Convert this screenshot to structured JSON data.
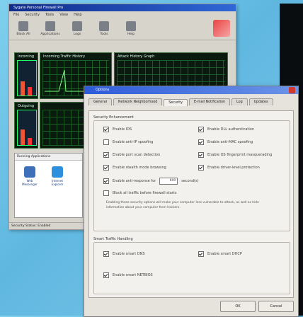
{
  "main": {
    "title": "Sygate Personal Firewall Pro",
    "menu": [
      "File",
      "Security",
      "Tools",
      "View",
      "Help"
    ],
    "toolbar": [
      {
        "label": "Block All",
        "icon": "stop-icon"
      },
      {
        "label": "Applications",
        "icon": "apps-icon"
      },
      {
        "label": "Logs",
        "icon": "logs-icon"
      },
      {
        "label": "Tools",
        "icon": "tools-icon"
      },
      {
        "label": "Help",
        "icon": "help-icon"
      }
    ],
    "panels": {
      "incoming": "Incoming",
      "traffic_history": "Incoming Traffic History",
      "attack_history": "Attack History Graph",
      "outgoing": "Outgoing"
    },
    "running_apps": {
      "header": "Running Applications",
      "apps": [
        "Web Messenger",
        "Internet Explorer"
      ]
    },
    "status": "Security Status: Enabled"
  },
  "dialog": {
    "title": "Options",
    "tabs": [
      "General",
      "Network Neighborhood",
      "Security",
      "E-mail Notification",
      "Log",
      "Updates"
    ],
    "active_tab": "Security",
    "security": {
      "enhancement_label": "Security Enhancement",
      "left": [
        {
          "label": "Enable IDS",
          "checked": true
        },
        {
          "label": "Enable anti-IP spoofing",
          "checked": false
        },
        {
          "label": "Enable port scan detection",
          "checked": true
        },
        {
          "label": "Enable stealth mode browsing",
          "checked": true
        },
        {
          "label": "Enable anti-MAC spoofing",
          "checked": true
        },
        {
          "label": "Block all traffic before firewall starts",
          "checked": false
        }
      ],
      "left_row_spin": {
        "label": "Enable anti-response for",
        "value": "600",
        "unit": "second(s)"
      },
      "right": [
        {
          "label": "Enable DLL authentication",
          "checked": true
        },
        {
          "label": "Enable anti-MAC spoofing",
          "checked": true
        },
        {
          "label": "Enable OS fingerprint masquerading",
          "checked": true
        },
        {
          "label": "Enable driver-level protection",
          "checked": true
        }
      ],
      "note": "Enabling these security options will make your computer less vulnerable to attack, as well as hide information about your computer from hackers.",
      "smart_label": "Smart Traffic Handling",
      "smart": [
        {
          "label": "Enable smart DNS",
          "checked": true
        },
        {
          "label": "Enable smart DHCP",
          "checked": true
        },
        {
          "label": "Enable smart NETBIOS",
          "checked": true
        }
      ]
    },
    "buttons": {
      "ok": "OK",
      "cancel": "Cancel"
    }
  }
}
